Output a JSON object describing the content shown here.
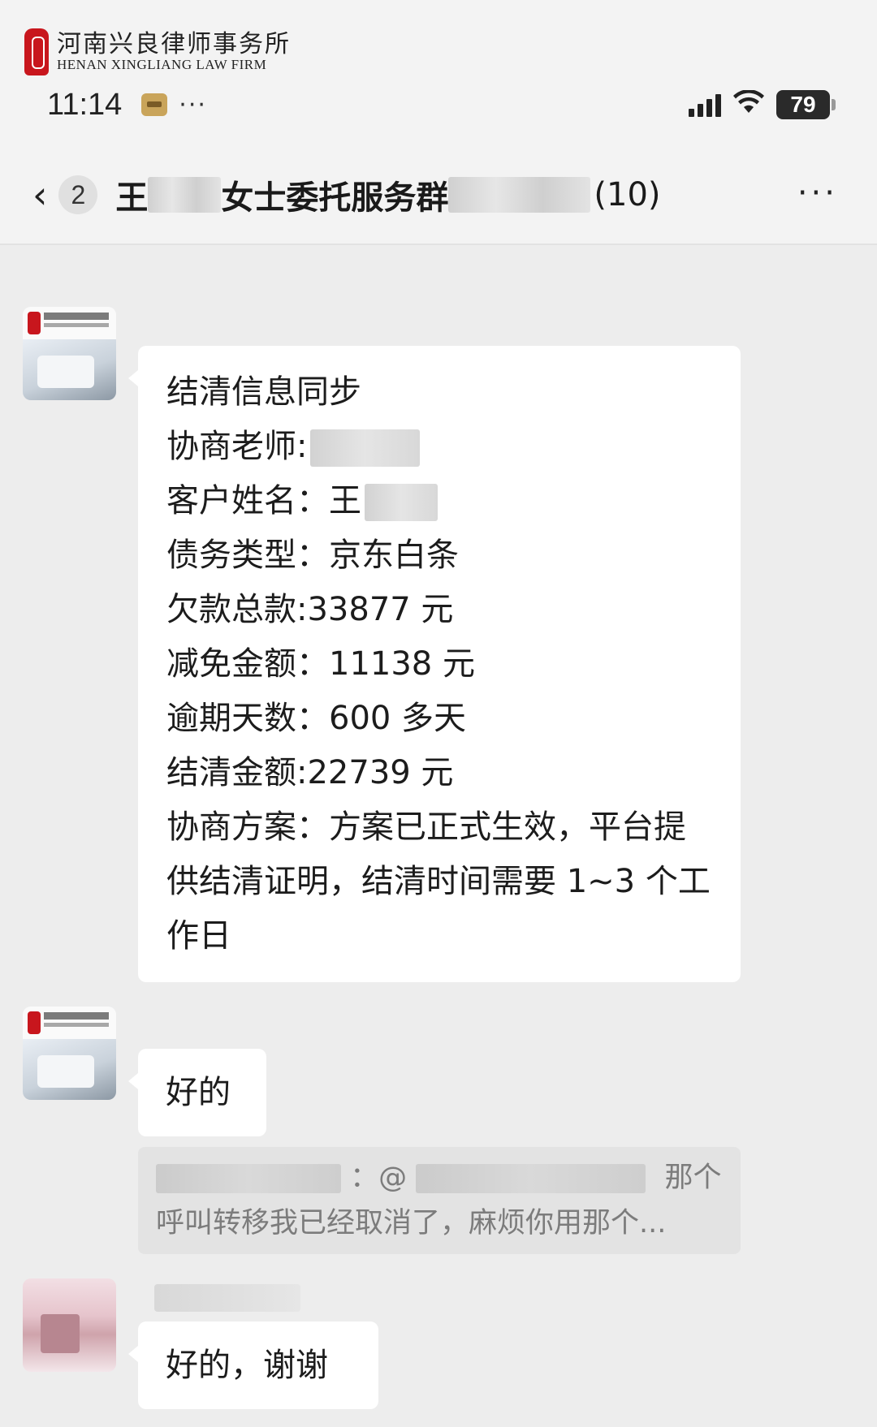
{
  "watermark": {
    "name_cn": "河南兴良律师事务所",
    "name_en": "HENAN XINGLIANG LAW FIRM"
  },
  "status_bar": {
    "time": "11:14",
    "more": "···",
    "battery": "79"
  },
  "nav": {
    "back_icon": "‹",
    "unread_count": "2",
    "title_prefix": "王",
    "title_middle": "女士委托服务群",
    "title_suffix": "(10)",
    "more_icon": "···"
  },
  "messages": [
    {
      "lines": {
        "l1": "结清信息同步",
        "l2": "协商老师:",
        "l3": "客户姓名：王",
        "l4": "债务类型：京东白条",
        "l5": "欠款总款:33877 元",
        "l6": "减免金额：11138 元",
        "l7": "逾期天数：600 多天",
        "l8": "结清金额:22739 元",
        "l9": "协商方案：方案已正式生效，平台提供结清证明，结清时间需要 1~3 个工作日"
      }
    },
    {
      "text": "好的"
    },
    {
      "text": "好的，谢谢"
    }
  ],
  "quote": {
    "sep": "：@",
    "tail": "那个",
    "line2": "呼叫转移我已经取消了，麻烦你用那个..."
  },
  "colors": {
    "background": "#ededed",
    "bubble": "#ffffff",
    "seal_red": "#c8161d"
  }
}
